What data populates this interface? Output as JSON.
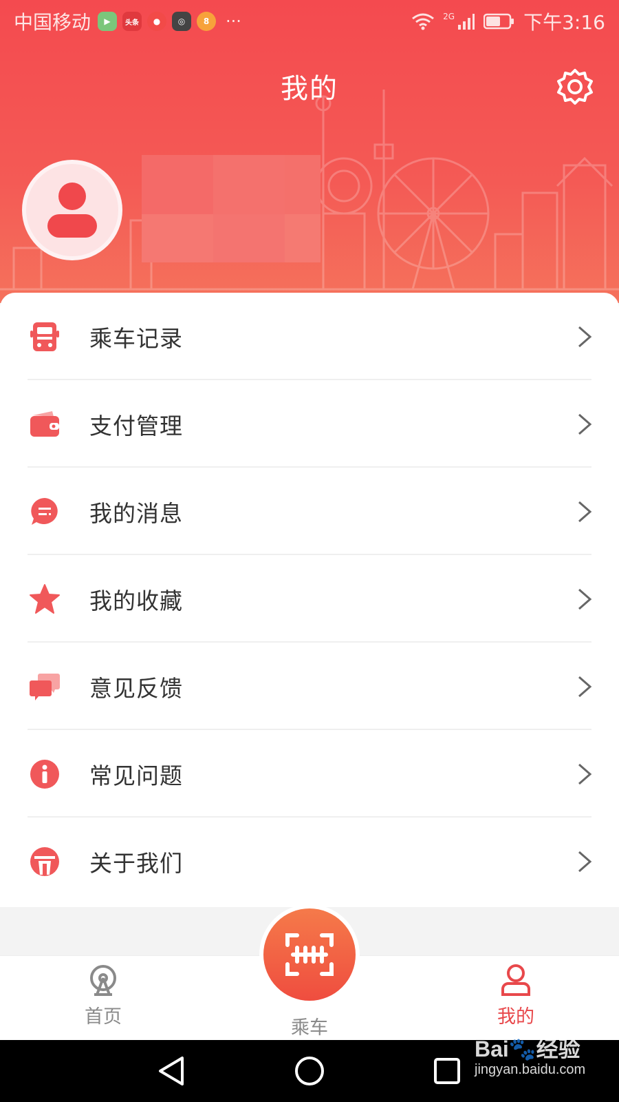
{
  "status_bar": {
    "carrier": "中国移动",
    "apps": [
      {
        "name": "video-app-icon",
        "color": "#7bc67b",
        "text": "▶"
      },
      {
        "name": "toutiao-app-icon",
        "color": "#e0393e",
        "text": "头条"
      },
      {
        "name": "douyin-app-icon",
        "color": "#f24a48",
        "text": "●"
      },
      {
        "name": "news-app-icon",
        "color": "#444444",
        "text": "◎"
      },
      {
        "name": "kuaishou-app-icon",
        "color": "#f7a23b",
        "text": "8"
      }
    ],
    "more": "···",
    "network_label": "2G",
    "time": "下午3:16"
  },
  "header": {
    "title": "我的"
  },
  "menu": [
    {
      "label": "乘车记录",
      "icon": "ride-record-icon"
    },
    {
      "label": "支付管理",
      "icon": "wallet-icon"
    },
    {
      "label": "我的消息",
      "icon": "message-icon"
    },
    {
      "label": "我的收藏",
      "icon": "star-icon"
    },
    {
      "label": "意见反馈",
      "icon": "feedback-icon"
    },
    {
      "label": "常见问题",
      "icon": "info-icon"
    },
    {
      "label": "关于我们",
      "icon": "about-icon"
    }
  ],
  "bottom_nav": {
    "home_label": "首页",
    "ride_label": "乘车",
    "mine_label": "我的",
    "active": "mine"
  },
  "watermark": {
    "brand": "Bai🐾经验",
    "url": "jingyan.baidu.com"
  },
  "colors": {
    "accent": "#e8484b",
    "header_top": "#f44a4f",
    "header_bottom": "#f5725c"
  }
}
